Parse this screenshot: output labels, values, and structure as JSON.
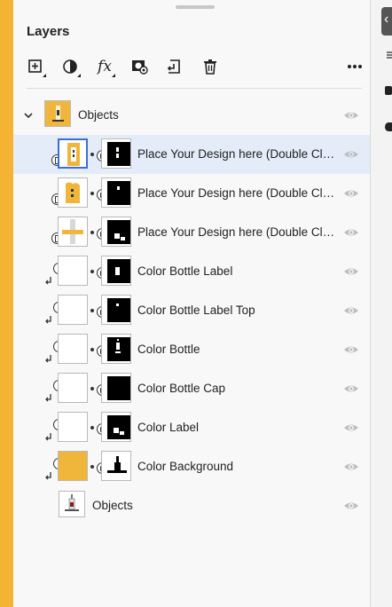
{
  "panel": {
    "title": "Layers"
  },
  "toolbar": {
    "tools": [
      {
        "icon": "add-layer-icon"
      },
      {
        "icon": "adjustment-layer-icon"
      },
      {
        "icon": "fx-icon",
        "label": "fx"
      },
      {
        "icon": "add-mask-icon"
      },
      {
        "icon": "clip-to-below-icon"
      },
      {
        "icon": "trash-icon"
      },
      {
        "icon": "more-options-icon"
      }
    ]
  },
  "layers": [
    {
      "label": "Objects",
      "kind": "group",
      "expanded": true
    },
    {
      "label": "Place Your Design here (Double Click to Edit)",
      "kind": "smart",
      "selected": true
    },
    {
      "label": "Place Your Design here (Double Click to Edit)",
      "kind": "smart"
    },
    {
      "label": "Place Your Design here (Double Click to Edit)",
      "kind": "smart"
    },
    {
      "label": "Color Bottle Label",
      "kind": "fill"
    },
    {
      "label": "Color Bottle Label Top",
      "kind": "fill"
    },
    {
      "label": "Color Bottle",
      "kind": "fill"
    },
    {
      "label": "Color Bottle Cap",
      "kind": "fill"
    },
    {
      "label": "Color Label",
      "kind": "fill"
    },
    {
      "label": "Color Background",
      "kind": "fill-orange"
    },
    {
      "label": "Objects",
      "kind": "image"
    }
  ],
  "colors": {
    "accent": "#f5b334",
    "selection": "#e3ecf8",
    "selection_border": "#3a6fd0"
  }
}
